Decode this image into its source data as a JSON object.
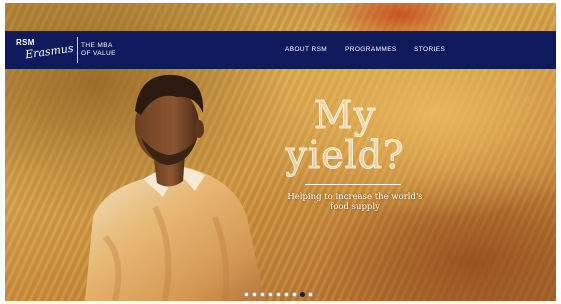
{
  "header": {
    "logo_rsm": "RSM",
    "logo_script": "Erasmus",
    "logo_tagline": "THE MBA\nOF VALUE",
    "nav": [
      "ABOUT RSM",
      "PROGRAMMES",
      "STORIES"
    ]
  },
  "hero": {
    "headline": "My yield?",
    "subline": "Helping to increase the world's food supply"
  },
  "carousel": {
    "slide_count": 9,
    "active_index": 7
  },
  "colors": {
    "navbar": "#0f1a5c",
    "hero_gold": "#d9a84f"
  }
}
